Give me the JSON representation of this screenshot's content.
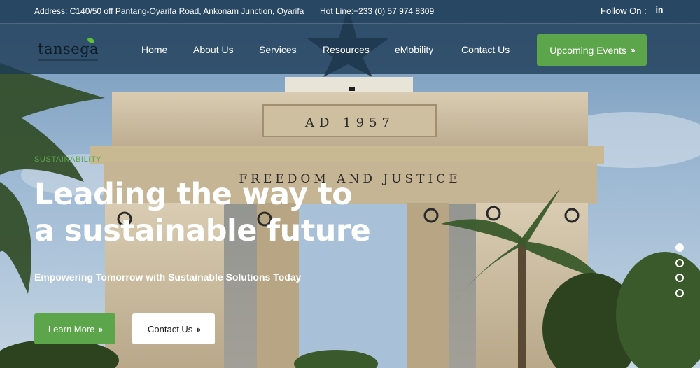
{
  "topbar": {
    "address": "Address: C140/50 off Pantang-Oyarifa Road, Ankonam Junction, Oyarifa",
    "hotline": "Hot Line:+233 (0) 57 974 8309",
    "follow_label": "Follow On :",
    "linkedin_icon": "linkedin-icon"
  },
  "logo": {
    "text": "tansega"
  },
  "nav": {
    "items": [
      {
        "label": "Home"
      },
      {
        "label": "About Us"
      },
      {
        "label": "Services"
      },
      {
        "label": "Resources"
      },
      {
        "label": "eMobility"
      },
      {
        "label": "Contact Us"
      }
    ],
    "cta_label": "Upcoming Events"
  },
  "hero": {
    "kicker": "SUSTAINABILITY",
    "headline_line1": "Leading the way to",
    "headline_line2": "a sustainable future",
    "subline": "Empowering Tomorrow with Sustainable Solutions Today",
    "primary_button": "Learn More",
    "secondary_button": "Contact Us",
    "arch_date": "AD 1957",
    "arch_motto": "FREEDOM AND JUSTICE"
  },
  "slider": {
    "count": 4,
    "active_index": 0
  },
  "colors": {
    "brand_green": "#5da54a",
    "nav_bg": "#1c3a54",
    "text_white": "#ffffff"
  },
  "icons": {
    "chevron": "double-chevron-right-icon",
    "star": "black-star-icon"
  }
}
